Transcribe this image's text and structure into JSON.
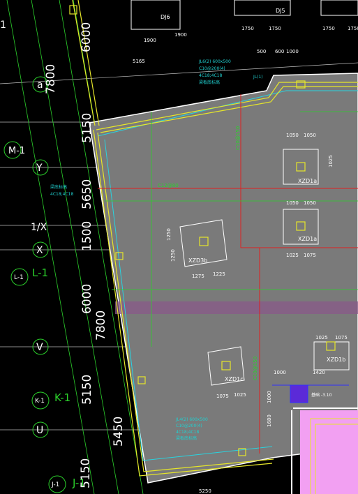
{
  "colors": {
    "background": "#000000",
    "slab": "#7a7a7a",
    "slab_outline": "#ffffff",
    "grid": "#cfcfcf",
    "axis_green": "#2bd12b",
    "beam_yellow": "#e6e62a",
    "wall_cyan": "#28d4e0",
    "red_line": "#e02020",
    "pink_zone": "#f2a0f2",
    "blue": "#3030ff",
    "cyan_note": "#20d0d0",
    "purple_band": "#8a5a8a"
  },
  "axis_dims": {
    "d6000_top": "6000",
    "d7800": "7800",
    "d5150_a": "5150",
    "d5650": "5650",
    "d1500": "1500",
    "d6000_mid": "6000",
    "d7800_b": "7800",
    "d5150_b": "5150",
    "d5450": "5450",
    "d5150_c": "5150"
  },
  "axis_labels": {
    "a": "a",
    "m1": "M-1",
    "y": "Y",
    "one_x": "1/X",
    "x": "X",
    "l1_circle": "L-1",
    "l1": "L-1",
    "v": "V",
    "k1_circle": "K-1",
    "k1": "K-1",
    "u": "U",
    "j1_circle": "J-1",
    "j1": "J-1",
    "i1": "1"
  },
  "foundations": {
    "dj6": "DJ6",
    "dj5": "DJ5",
    "xzd1a_top": "XZD1a",
    "xzd1a_mid": "XZD1a",
    "xzd3b": "XZD3b",
    "xzd1c": "XZD1c",
    "xzd1b": "XZD1b"
  },
  "dims_small": {
    "top_1900_a": "1900",
    "top_1900_b": "1900",
    "top_1750_a": "1750",
    "top_1750_b": "1750",
    "top_1750_c": "1750",
    "top_1750_d": "1750",
    "d500": "500",
    "d600": "600",
    "d1000": "1000",
    "d5165": "5165",
    "d1050_a": "1050",
    "d1050_b": "1050",
    "d1050_c": "1050",
    "d1050_d": "1050",
    "d1025_a": "1025",
    "d1075_a": "1075",
    "d1250_a": "1250",
    "d1250_b": "1250",
    "d1275": "1275",
    "d1225": "1225",
    "d1025_b": "1025",
    "d1075_b": "1075",
    "d1025_c": "1025",
    "d1025_d": "1025",
    "d1075_c": "1075",
    "d1000_b": "1000",
    "d1420": "1420",
    "d1000_c": "1000",
    "d1680": "1680",
    "d5250": "5250"
  },
  "beam_notes": {
    "top_l1": "JL6(2) 600x500",
    "top_l2": "C10@200(4)",
    "top_l3": "4C18;4C18",
    "top_l4": "梁板底标高",
    "bot_l1": "JL4(2) 600x500",
    "bot_l2": "C10@200(4)",
    "bot_l3": "4C18;4C18",
    "bot_l4": "梁板底标高",
    "left_l1": "梁底标高",
    "left_l2": "4C18;4C18",
    "c12": "C12@80",
    "mid_tag": "C10@150",
    "low_tag": "C10@150",
    "blue_tag": "基础 -3.10",
    "js1": "JL(1)"
  }
}
